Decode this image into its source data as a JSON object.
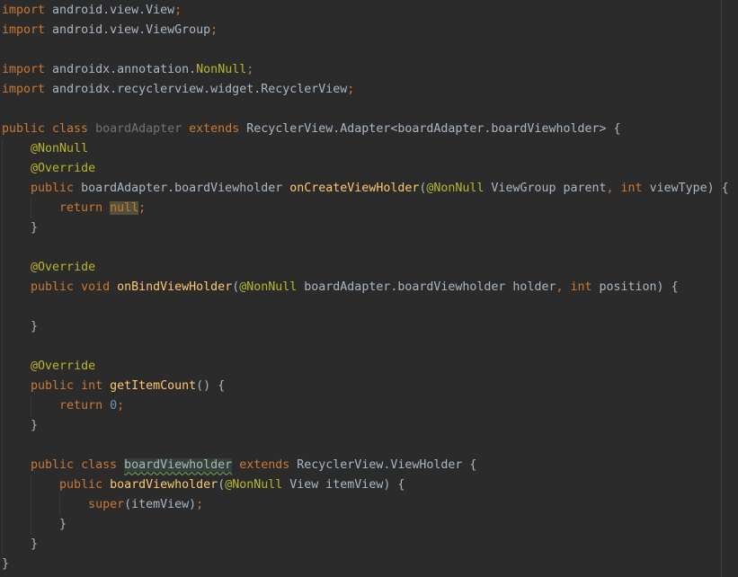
{
  "editor": {
    "language": "Java",
    "colors": {
      "background": "#2b2b2b",
      "plain": "#a9b7c6",
      "keyword": "#cc7832",
      "annotation": "#bbb529",
      "method": "#ffc66d",
      "number": "#6897bb",
      "unused": "#72737a"
    },
    "lines": [
      {
        "indent": 0,
        "tokens": [
          {
            "t": "import",
            "c": "kw"
          },
          {
            "t": " android.view.View",
            "c": "pl"
          },
          {
            "t": ";",
            "c": "kw"
          }
        ]
      },
      {
        "indent": 0,
        "tokens": [
          {
            "t": "import",
            "c": "kw"
          },
          {
            "t": " android.view.ViewGroup",
            "c": "pl"
          },
          {
            "t": ";",
            "c": "kw"
          }
        ]
      },
      {
        "indent": 0,
        "tokens": []
      },
      {
        "indent": 0,
        "tokens": [
          {
            "t": "import",
            "c": "kw"
          },
          {
            "t": " androidx.annotation.",
            "c": "pl"
          },
          {
            "t": "NonNull",
            "c": "an"
          },
          {
            "t": ";",
            "c": "kw"
          }
        ]
      },
      {
        "indent": 0,
        "tokens": [
          {
            "t": "import",
            "c": "kw"
          },
          {
            "t": " androidx.recyclerview.widget.RecyclerView",
            "c": "pl"
          },
          {
            "t": ";",
            "c": "kw"
          }
        ]
      },
      {
        "indent": 0,
        "tokens": []
      },
      {
        "indent": 0,
        "tokens": [
          {
            "t": "public class ",
            "c": "kw"
          },
          {
            "t": "boardAdapter",
            "c": "unused"
          },
          {
            "t": " extends ",
            "c": "kw"
          },
          {
            "t": "RecyclerView.Adapter<boardAdapter.boardViewholder> {",
            "c": "pl"
          }
        ]
      },
      {
        "indent": 1,
        "tokens": [
          {
            "t": "@NonNull",
            "c": "an"
          }
        ]
      },
      {
        "indent": 1,
        "tokens": [
          {
            "t": "@Override",
            "c": "an"
          }
        ]
      },
      {
        "indent": 1,
        "tokens": [
          {
            "t": "public ",
            "c": "kw"
          },
          {
            "t": "boardAdapter.boardViewholder ",
            "c": "pl"
          },
          {
            "t": "onCreateViewHolder",
            "c": "fn"
          },
          {
            "t": "(",
            "c": "pl"
          },
          {
            "t": "@NonNull",
            "c": "an"
          },
          {
            "t": " ViewGroup parent",
            "c": "pl"
          },
          {
            "t": ", ",
            "c": "kw"
          },
          {
            "t": "int ",
            "c": "kw"
          },
          {
            "t": "viewType) {",
            "c": "pl"
          }
        ]
      },
      {
        "indent": 2,
        "tokens": [
          {
            "t": "return ",
            "c": "kw"
          },
          {
            "t": "null",
            "c": "kw hl-warn"
          },
          {
            "t": ";",
            "c": "kw"
          }
        ]
      },
      {
        "indent": 1,
        "tokens": [
          {
            "t": "}",
            "c": "pl"
          }
        ]
      },
      {
        "indent": 1,
        "tokens": []
      },
      {
        "indent": 1,
        "tokens": [
          {
            "t": "@Override",
            "c": "an"
          }
        ]
      },
      {
        "indent": 1,
        "tokens": [
          {
            "t": "public void ",
            "c": "kw"
          },
          {
            "t": "onBindViewHolder",
            "c": "fn"
          },
          {
            "t": "(",
            "c": "pl"
          },
          {
            "t": "@NonNull",
            "c": "an"
          },
          {
            "t": " boardAdapter.boardViewholder holder",
            "c": "pl"
          },
          {
            "t": ", ",
            "c": "kw"
          },
          {
            "t": "int ",
            "c": "kw"
          },
          {
            "t": "position) {",
            "c": "pl"
          }
        ]
      },
      {
        "indent": 1,
        "tokens": []
      },
      {
        "indent": 1,
        "tokens": [
          {
            "t": "}",
            "c": "pl"
          }
        ]
      },
      {
        "indent": 1,
        "tokens": []
      },
      {
        "indent": 1,
        "tokens": [
          {
            "t": "@Override",
            "c": "an"
          }
        ]
      },
      {
        "indent": 1,
        "tokens": [
          {
            "t": "public int ",
            "c": "kw"
          },
          {
            "t": "getItemCount",
            "c": "fn"
          },
          {
            "t": "() {",
            "c": "pl"
          }
        ]
      },
      {
        "indent": 2,
        "tokens": [
          {
            "t": "return ",
            "c": "kw"
          },
          {
            "t": "0",
            "c": "num"
          },
          {
            "t": ";",
            "c": "kw"
          }
        ]
      },
      {
        "indent": 1,
        "tokens": [
          {
            "t": "}",
            "c": "pl"
          }
        ]
      },
      {
        "indent": 1,
        "tokens": []
      },
      {
        "indent": 1,
        "tokens": [
          {
            "t": "public class ",
            "c": "kw"
          },
          {
            "t": "boardViewholder",
            "c": "pl hl-name"
          },
          {
            "t": " extends ",
            "c": "kw"
          },
          {
            "t": "RecyclerView.ViewHolder {",
            "c": "pl"
          }
        ]
      },
      {
        "indent": 2,
        "tokens": [
          {
            "t": "public ",
            "c": "kw"
          },
          {
            "t": "boardViewholder",
            "c": "fn"
          },
          {
            "t": "(",
            "c": "pl"
          },
          {
            "t": "@NonNull",
            "c": "an"
          },
          {
            "t": " View itemView) {",
            "c": "pl"
          }
        ]
      },
      {
        "indent": 3,
        "tokens": [
          {
            "t": "super",
            "c": "kw"
          },
          {
            "t": "(itemView)",
            "c": "pl"
          },
          {
            "t": ";",
            "c": "kw"
          }
        ]
      },
      {
        "indent": 2,
        "tokens": [
          {
            "t": "}",
            "c": "pl"
          }
        ]
      },
      {
        "indent": 1,
        "tokens": [
          {
            "t": "}",
            "c": "pl"
          }
        ]
      },
      {
        "indent": 0,
        "tokens": [
          {
            "t": "}",
            "c": "pl"
          }
        ]
      }
    ]
  }
}
